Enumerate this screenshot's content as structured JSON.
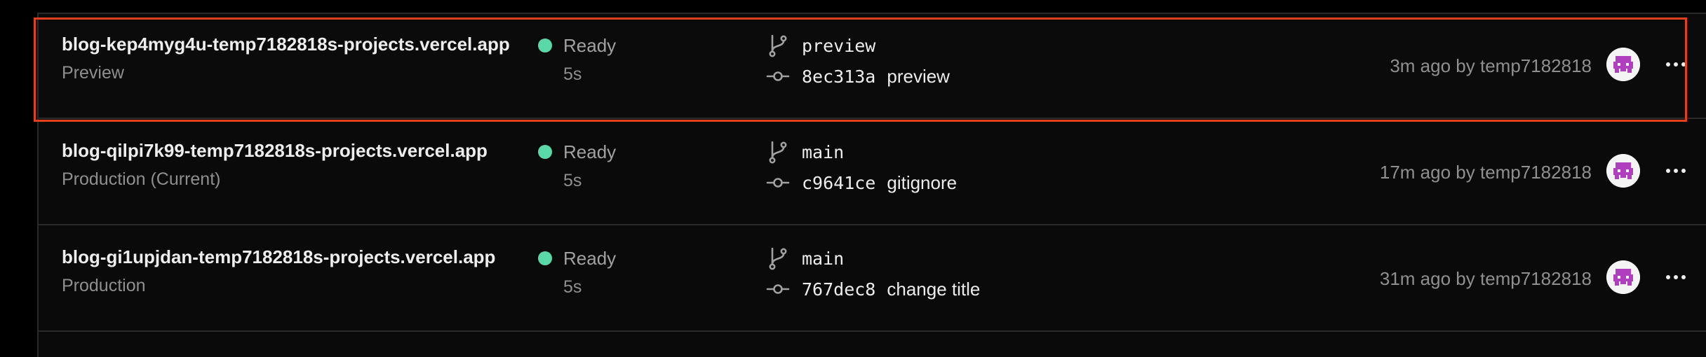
{
  "deployments": [
    {
      "url": "blog-kep4myg4u-temp7182818s-projects.vercel.app",
      "environment": "Preview",
      "status": "Ready",
      "duration": "5s",
      "branch": "preview",
      "commit_sha": "8ec313a",
      "commit_message": "preview",
      "meta": "3m ago by temp7182818",
      "selected": true
    },
    {
      "url": "blog-qilpi7k99-temp7182818s-projects.vercel.app",
      "environment": "Production (Current)",
      "status": "Ready",
      "duration": "5s",
      "branch": "main",
      "commit_sha": "c9641ce",
      "commit_message": "gitignore",
      "meta": "17m ago by temp7182818",
      "selected": false
    },
    {
      "url": "blog-gi1upjdan-temp7182818s-projects.vercel.app",
      "environment": "Production",
      "status": "Ready",
      "duration": "5s",
      "branch": "main",
      "commit_sha": "767dec8",
      "commit_message": "change title",
      "meta": "31m ago by temp7182818",
      "selected": false
    }
  ],
  "icons": {
    "status": "status-dot-icon",
    "branch": "git-branch-icon",
    "commit": "git-commit-icon",
    "avatar": "user-avatar-icon",
    "more": "more-horizontal-icon"
  },
  "colors": {
    "background": "#0a0a0a",
    "status_ready": "#5ad8a6",
    "highlight": "#e2401f",
    "avatar_accent": "#b03fbf"
  }
}
